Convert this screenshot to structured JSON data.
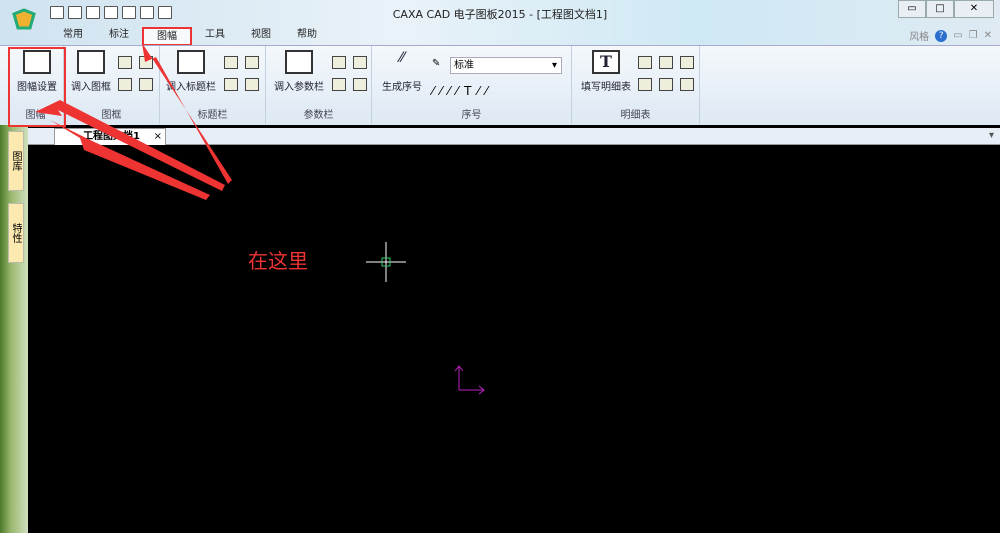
{
  "window": {
    "title": "CAXA CAD 电子图板2015 - [工程图文档1]",
    "min": "▭",
    "max": "□",
    "close": "✕"
  },
  "menus": [
    "常用",
    "标注",
    "图幅",
    "工具",
    "视图",
    "帮助"
  ],
  "right_tools": {
    "style": "风格",
    "help": "?"
  },
  "ribbon": {
    "groups": [
      {
        "label": "图幅",
        "buttons": [
          "图幅设置"
        ]
      },
      {
        "label": "图框",
        "buttons": [
          "调入图框"
        ]
      },
      {
        "label": "标题栏",
        "buttons": [
          "调入标题栏"
        ]
      },
      {
        "label": "参数栏",
        "buttons": [
          "调入参数栏"
        ]
      },
      {
        "label": "序号",
        "buttons": [
          "生成序号"
        ],
        "select": "标准"
      },
      {
        "label": "明细表",
        "buttons": [
          "填写明细表"
        ]
      }
    ]
  },
  "doc_tab": {
    "label": "工程图文档1",
    "close": "×"
  },
  "side_tabs": [
    "图库",
    "特性"
  ],
  "annotation": "在这里",
  "colors": {
    "highlight": "#e33333",
    "crosshair": "#ffffff",
    "ucs": "#c020c0"
  }
}
